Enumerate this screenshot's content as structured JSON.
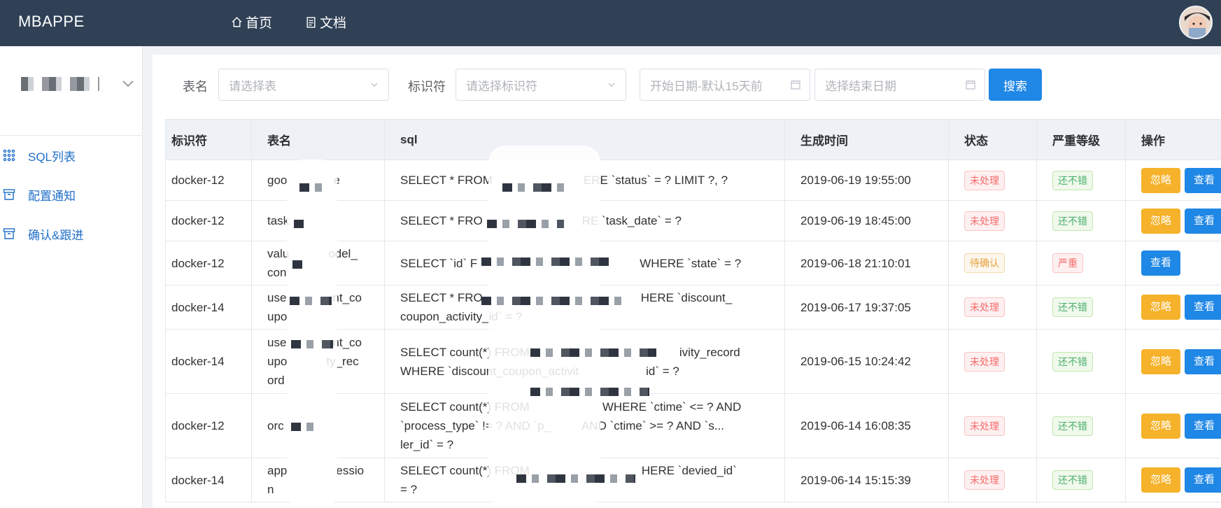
{
  "topbar": {
    "brand": "MBAPPE",
    "nav": [
      {
        "label": "首页",
        "icon": "home-icon"
      },
      {
        "label": "文档",
        "icon": "document-icon"
      }
    ],
    "avatar_icon": "user-avatar"
  },
  "sidebar": {
    "app_select_icon": "chevron-down-icon",
    "items": [
      {
        "label": "SQL列表",
        "icon": "grid-icon"
      },
      {
        "label": "配置通知",
        "icon": "archive-icon"
      },
      {
        "label": "确认&跟进",
        "icon": "archive-icon"
      }
    ]
  },
  "filters": {
    "table_label": "表名",
    "table_placeholder": "请选择表",
    "id_label": "标识符",
    "id_placeholder": "请选择标识符",
    "start_placeholder": "开始日期-默认15天前",
    "end_placeholder": "选择结束日期",
    "search_label": "搜索"
  },
  "table": {
    "headers": [
      "标识符",
      "表名",
      "sql",
      "生成时间",
      "状态",
      "严重等级",
      "操作"
    ],
    "rows": [
      {
        "id": "docker-12",
        "table": "goo",
        "table_tail": "e",
        "sql": "SELECT * FROM",
        "sql_tail": "ERE `status` = ? LIMIT ?, ?",
        "time": "2019-06-19 19:55:00",
        "status": "未处理",
        "level": "还不错",
        "actions": [
          "忽略",
          "查看"
        ]
      },
      {
        "id": "docker-12",
        "table": "task",
        "table_tail": "",
        "sql": "SELECT * FRO",
        "sql_tail": "RE `task_date` = ?",
        "time": "2019-06-19 18:45:00",
        "status": "未处理",
        "level": "还不错",
        "actions": [
          "忽略",
          "查看"
        ]
      },
      {
        "id": "docker-12",
        "table": "valu",
        "table_tail": "odel_",
        "table_line2": "con",
        "sql": "SELECT `id` F",
        "sql_tail": "WHERE `state` = ?",
        "time": "2019-06-18 21:10:01",
        "status": "待确认",
        "level": "严重",
        "actions": [
          "查看"
        ]
      },
      {
        "id": "docker-14",
        "table": "use",
        "table_tail": "nt_co",
        "table_line2": "upo",
        "sql": "SELECT * FRO",
        "sql_tail": "HERE `discount_",
        "sql_line2": "coupon_activity_id` = ?",
        "time": "2019-06-17 19:37:05",
        "status": "未处理",
        "level": "还不错",
        "actions": [
          "忽略",
          "查看"
        ]
      },
      {
        "id": "docker-14",
        "table": "use",
        "table_tail": "nt_co",
        "table_line2": "upo",
        "table_line2_tail": "ty_rec",
        "table_line3": "ord",
        "sql": "SELECT count(*) FROM",
        "sql_tail": "ivity_record",
        "sql_line2": "WHERE `discount_coupon_activit",
        "sql_line2_tail": "id` = ?",
        "time": "2019-06-15 10:24:42",
        "status": "未处理",
        "level": "还不错",
        "actions": [
          "忽略",
          "查看"
        ]
      },
      {
        "id": "docker-12",
        "table": "orc",
        "table_tail": "",
        "sql": "SELECT count(*) FROM",
        "sql_tail": "WHERE `ctime` <= ? AND",
        "sql_line2": "`process_type` != ? AND `p_",
        "sql_line2_tail": "AND `ctime` >= ? AND `s...",
        "sql_line3": "ler_id` = ?",
        "time": "2019-06-14 16:08:35",
        "status": "未处理",
        "level": "还不错",
        "actions": [
          "忽略",
          "查看"
        ]
      },
      {
        "id": "docker-14",
        "table": "app",
        "table_tail": "essio",
        "table_line2": "n",
        "sql": "SELECT count(*) FROM",
        "sql_tail": "HERE `devied_id`",
        "sql_line2": "= ?",
        "time": "2019-06-14 15:15:39",
        "status": "未处理",
        "level": "还不错",
        "actions": [
          "忽略",
          "查看"
        ]
      }
    ]
  },
  "colors": {
    "topbar": "#304156",
    "primary": "#1f87e5",
    "warning": "#f5b22a",
    "danger": "#f56c6c",
    "success": "#4caf70"
  }
}
